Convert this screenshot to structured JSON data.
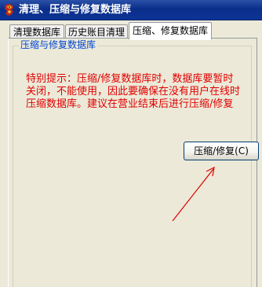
{
  "window": {
    "title": "清理、压缩与修复数据库"
  },
  "tabs": [
    {
      "label": "清理数据库",
      "active": false
    },
    {
      "label": "历史账目清理",
      "active": false
    },
    {
      "label": "压缩、修复数据库",
      "active": true
    }
  ],
  "group": {
    "legend": "压缩与修复数据库"
  },
  "notice": {
    "text": "特别提示：压缩/修复数据库时，数据库要暂时\n关闭，不能使用，因此要确保在没有用户在线时\n压缩数据库。建议在营业结束后进行压缩/修复"
  },
  "button": {
    "label": "压缩/修复(C)"
  },
  "icons": {
    "app": "dragon-icon"
  },
  "colors": {
    "titlebar": "#0a2f8a",
    "notice_text": "#e10000",
    "legend_text": "#0046d5",
    "annotation_arrow": "#e00000"
  }
}
